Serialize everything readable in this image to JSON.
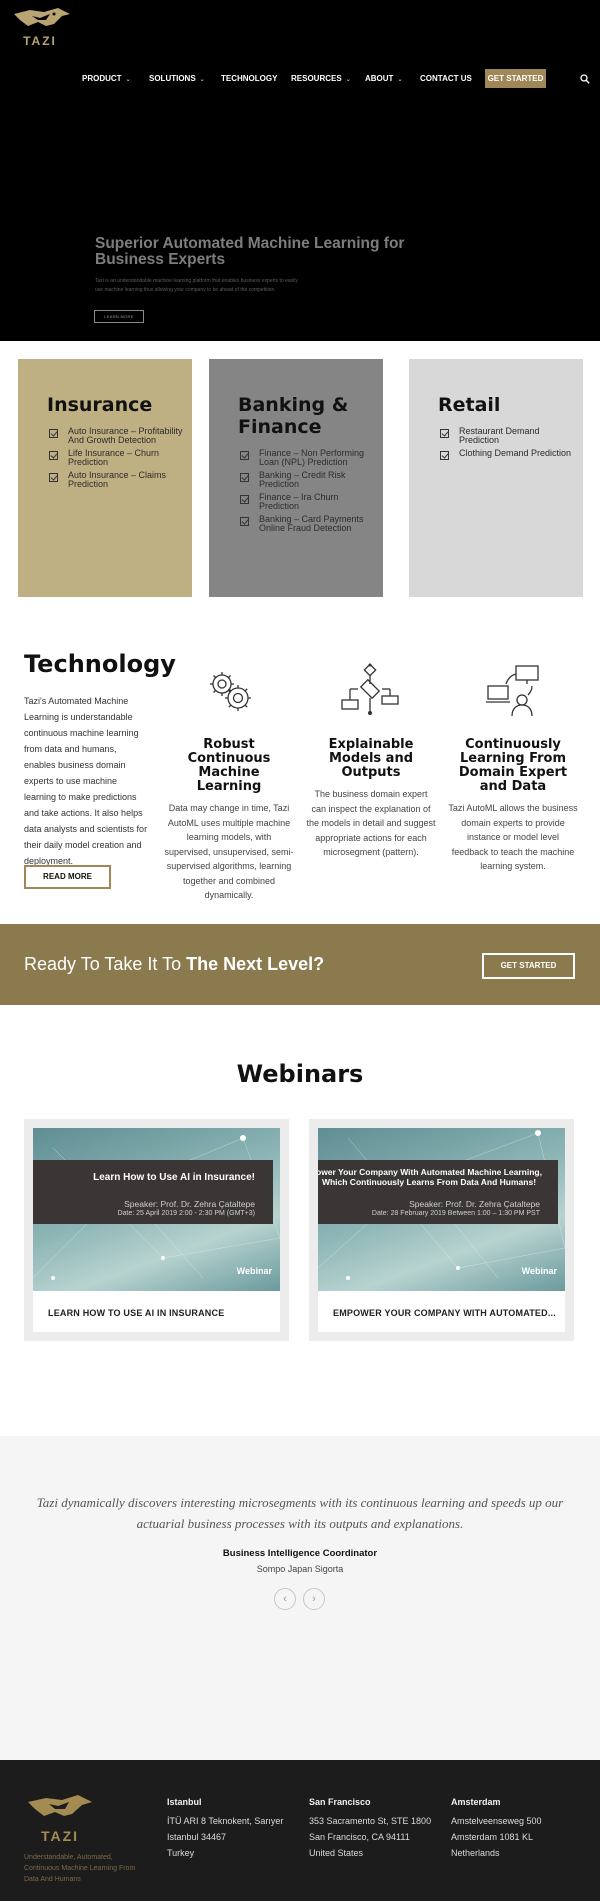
{
  "brand": {
    "name": "TAZI",
    "color": "#9f8757"
  },
  "nav": {
    "items": [
      {
        "label": "PRODUCT",
        "dropdown": true
      },
      {
        "label": "SOLUTIONS",
        "dropdown": true
      },
      {
        "label": "TECHNOLOGY",
        "dropdown": false
      },
      {
        "label": "RESOURCES",
        "dropdown": true
      },
      {
        "label": "ABOUT",
        "dropdown": true
      },
      {
        "label": "CONTACT US",
        "dropdown": false
      }
    ],
    "cta": "GET STARTED",
    "search_icon": "search-icon"
  },
  "hero": {
    "title": "Superior Automated Machine Learning for Business Experts",
    "subtitle": "Tazi is an understandable machine learning platform that enables business experts to easily use machine learning thus allowing your company to be ahead of the competition.",
    "button": "LEARN MORE"
  },
  "industries": [
    {
      "title": "Insurance",
      "items": [
        "Auto Insurance – Profitability And Growth Detection",
        "Life Insurance – Churn Prediction",
        "Auto Insurance – Claims Prediction"
      ]
    },
    {
      "title": "Banking & Finance",
      "items": [
        "Finance – Non Performing Loan (NPL) Prediction",
        "Banking – Credit Risk Prediction",
        "Finance – Ira Churn Prediction",
        "Banking – Card Payments Online Fraud Detection"
      ]
    },
    {
      "title": "Retail",
      "items": [
        "Restaurant Demand Prediction",
        "Clothing Demand Prediction"
      ]
    }
  ],
  "technology": {
    "title": "Technology",
    "text": "Tazi's Automated Machine Learning is understandable continuous machine learning from data and humans, enables business domain experts to use machine learning to make predictions and take actions. It also helps data analysts and scientists for their daily model creation and deployment.",
    "button": "READ MORE",
    "features": [
      {
        "icon": "gears-icon",
        "title": "Robust Continuous Machine Learning",
        "text": "Data may change in time, Tazi AutoML uses multiple machine learning models, with supervised, unsupervised, semi-supervised algorithms, learning together and combined dynamically."
      },
      {
        "icon": "flowchart-icon",
        "title": "Explainable Models and Outputs",
        "text": "The business domain expert can inspect the explanation of the models in detail and suggest appropriate actions for each microsegment (pattern)."
      },
      {
        "icon": "expert-computers-icon",
        "title": "Continuously Learning From Domain Expert and Data",
        "text": "Tazi AutoML allows the business domain experts to provide instance or model level feedback to teach the machine learning system."
      }
    ]
  },
  "cta_band": {
    "text_plain": "Ready To Take It To ",
    "text_bold": "The Next Level?",
    "button": "GET STARTED"
  },
  "webinars": {
    "title": "Webinars",
    "items": [
      {
        "image_title": "Learn How to Use AI in Insurance!",
        "speaker": "Speaker:  Prof. Dr. Zehra Çataltepe",
        "date": "Date: 25 April 2019  2:00 - 2:30 PM (GMT+3)",
        "tag": "Webinar",
        "caption": "LEARN HOW TO USE AI IN INSURANCE"
      },
      {
        "image_title": "ower Your Company With Automated Machine Learning, Which Continuously Learns From Data And Humans!",
        "speaker": "Speaker:  Prof. Dr. Zehra Çataltepe",
        "date": "Date: 28 February 2019 Between 1:00 – 1:30 PM PST",
        "tag": "Webinar",
        "caption": "EMPOWER YOUR COMPANY WITH AUTOMATED..."
      }
    ]
  },
  "testimonial": {
    "quote": "Tazi dynamically discovers interesting microsegments with its continuous learning and speeds up our actuarial business processes with its outputs and explanations.",
    "role": "Business Intelligence Coordinator",
    "company": "Sompo Japan Sigorta",
    "prev": "‹",
    "next": "›"
  },
  "footer": {
    "tagline": "Understandable, Automated, Continuous Machine Learning From Data And Humans",
    "offices": [
      {
        "city": "Istanbul",
        "lines": [
          "İTÜ ARI 8 Teknokent, Sarıyer",
          "Istanbul 34467",
          "Turkey"
        ]
      },
      {
        "city": "San Francisco",
        "lines": [
          "353 Sacramento St, STE 1800",
          "San Francisco, CA 94111",
          "United States"
        ]
      },
      {
        "city": "Amsterdam",
        "lines": [
          "Amstelveenseweg 500",
          "Amsterdam 1081 KL",
          "Netherlands"
        ]
      }
    ]
  }
}
